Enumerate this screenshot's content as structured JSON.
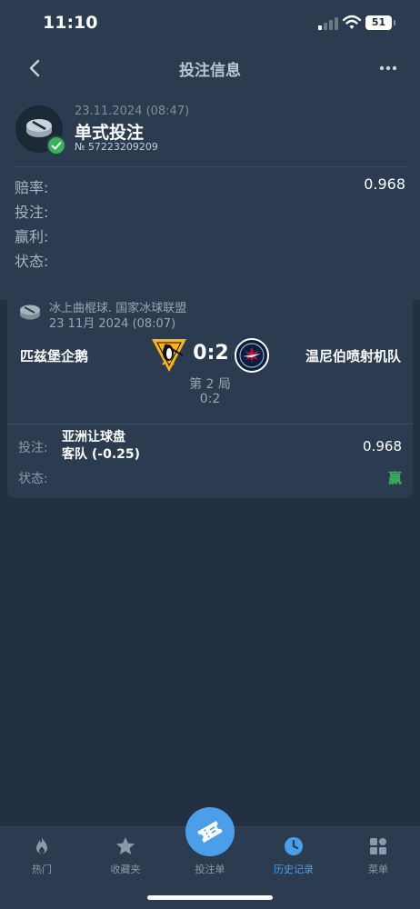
{
  "status_bar": {
    "time": "11:10",
    "battery": "51"
  },
  "header": {
    "title": "投注信息"
  },
  "bet": {
    "date": "23.11.2024 (08:47)",
    "type": "单式投注",
    "number": "№ 57223209209"
  },
  "summary": {
    "rows": [
      {
        "label": "赔率:",
        "value": "0.968"
      },
      {
        "label": "投注:",
        "value": ""
      },
      {
        "label": "赢利:",
        "value": ""
      },
      {
        "label": "状态:",
        "value": ""
      }
    ]
  },
  "match": {
    "league": "冰上曲棍球. 国家冰球联盟",
    "date": "23 11月 2024 (08:07)",
    "home_team": "匹兹堡企鹅",
    "away_team": "温尼伯喷射机队",
    "score": "0:2",
    "period": "第 2 局",
    "period_score": "0:2",
    "bet_label": "投注:",
    "market": "亚洲让球盘",
    "selection": "客队 (-0.25)",
    "odds": "0.968",
    "status_label": "状态:",
    "status": "赢",
    "status_color": "#38b25a"
  },
  "tabbar": {
    "tabs": [
      {
        "label": "热门",
        "icon": "flame-icon"
      },
      {
        "label": "收藏夹",
        "icon": "star-icon"
      },
      {
        "label": "投注单",
        "icon": "ticket-icon"
      },
      {
        "label": "历史记录",
        "icon": "clock-icon",
        "active": true
      },
      {
        "label": "菜单",
        "icon": "grid-icon"
      }
    ]
  },
  "colors": {
    "background": "#223041",
    "card": "#2b3c51",
    "accent": "#4a9fe8",
    "win": "#38b25a"
  }
}
